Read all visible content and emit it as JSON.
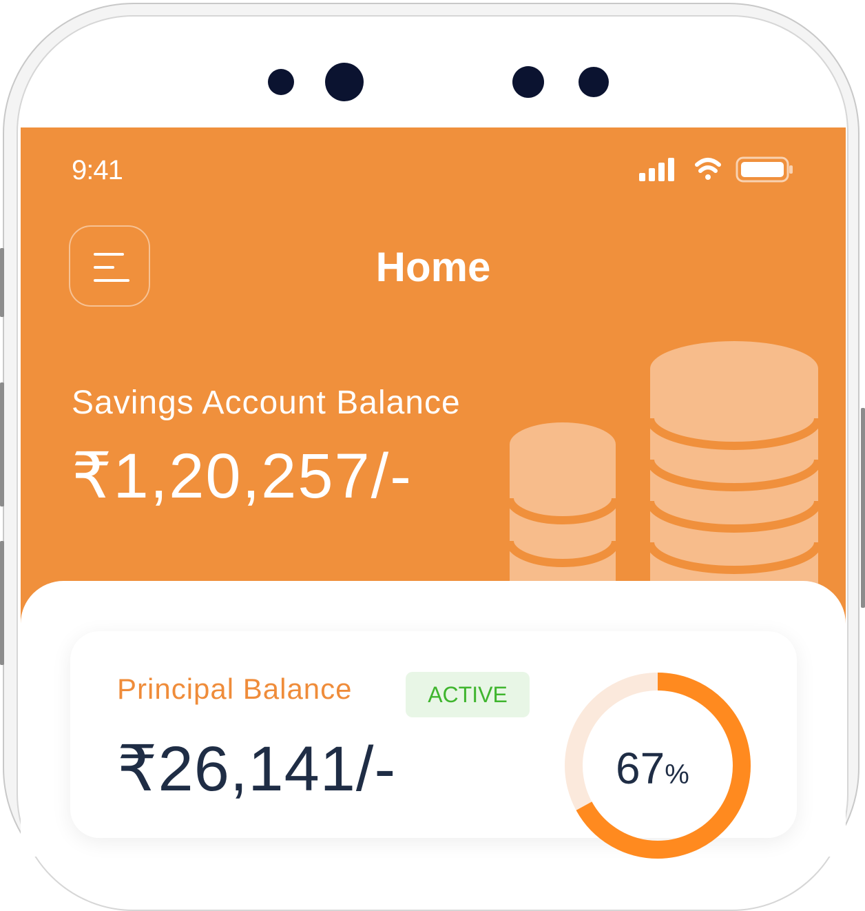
{
  "status_bar": {
    "time": "9:41",
    "icons": [
      "cellular-signal-icon",
      "wifi-icon",
      "battery-icon"
    ]
  },
  "header": {
    "menu_icon": "hamburger-menu-icon",
    "title": "Home"
  },
  "savings": {
    "label": "Savings Account Balance",
    "amount": "₹1,20,257/-",
    "illustration": "coins-stack-icon"
  },
  "principal_card": {
    "label": "Principal Balance",
    "status_badge": "ACTIVE",
    "amount": "₹26,141/-",
    "progress_value": "67",
    "progress_unit": "%",
    "progress_fraction": 0.67
  },
  "colors": {
    "primary": "#f0903c",
    "ring": "#ff8a1f",
    "ring_track": "#fbe9dc",
    "badge_bg": "#e8f6e6",
    "badge_text": "#3fb52e",
    "text_dark": "#1f2d45"
  }
}
